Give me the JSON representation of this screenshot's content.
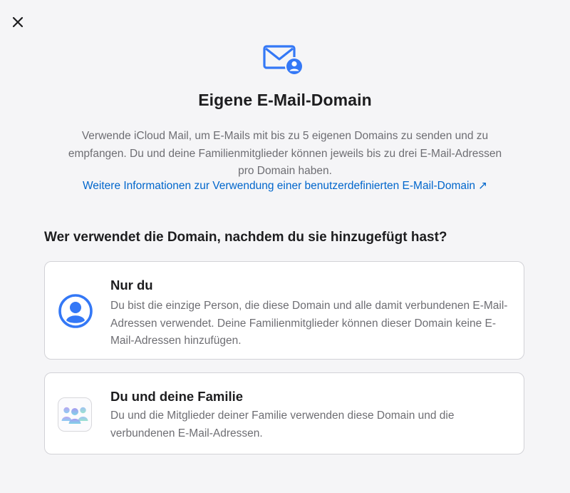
{
  "dialog": {
    "close_icon": "close-icon",
    "hero_icon": "mail-person-icon",
    "title": "Eigene E-Mail-Domain",
    "description": "Verwende iCloud Mail, um E-Mails mit bis zu 5 eigenen Domains zu senden und zu empfangen. Du und deine Familienmitglieder können jeweils bis zu drei E-Mail-Adressen pro Domain haben.",
    "info_link": "Weitere Informationen zur Verwendung einer benutzerdefinierten E-Mail-Domain",
    "info_link_arrow": "↗",
    "question": "Wer verwendet die Domain, nachdem du sie hinzugefügt hast?",
    "options": [
      {
        "icon": "person-circle-icon",
        "title": "Nur du",
        "text": "Du bist die einzige Person, die diese Domain und alle damit verbundenen E-Mail-Adressen verwendet. Deine Familienmitglieder können dieser Domain keine E-Mail-Adressen hinzufügen."
      },
      {
        "icon": "family-icon",
        "title": "Du und deine Familie",
        "text": "Du und die Mitglieder deiner Familie verwenden diese Domain und die verbundenen E-Mail-Adressen."
      }
    ]
  },
  "colors": {
    "accent": "#3478f6",
    "link": "#0066cc",
    "background": "#f5f5f7",
    "secondary_text": "#6e6e73"
  }
}
